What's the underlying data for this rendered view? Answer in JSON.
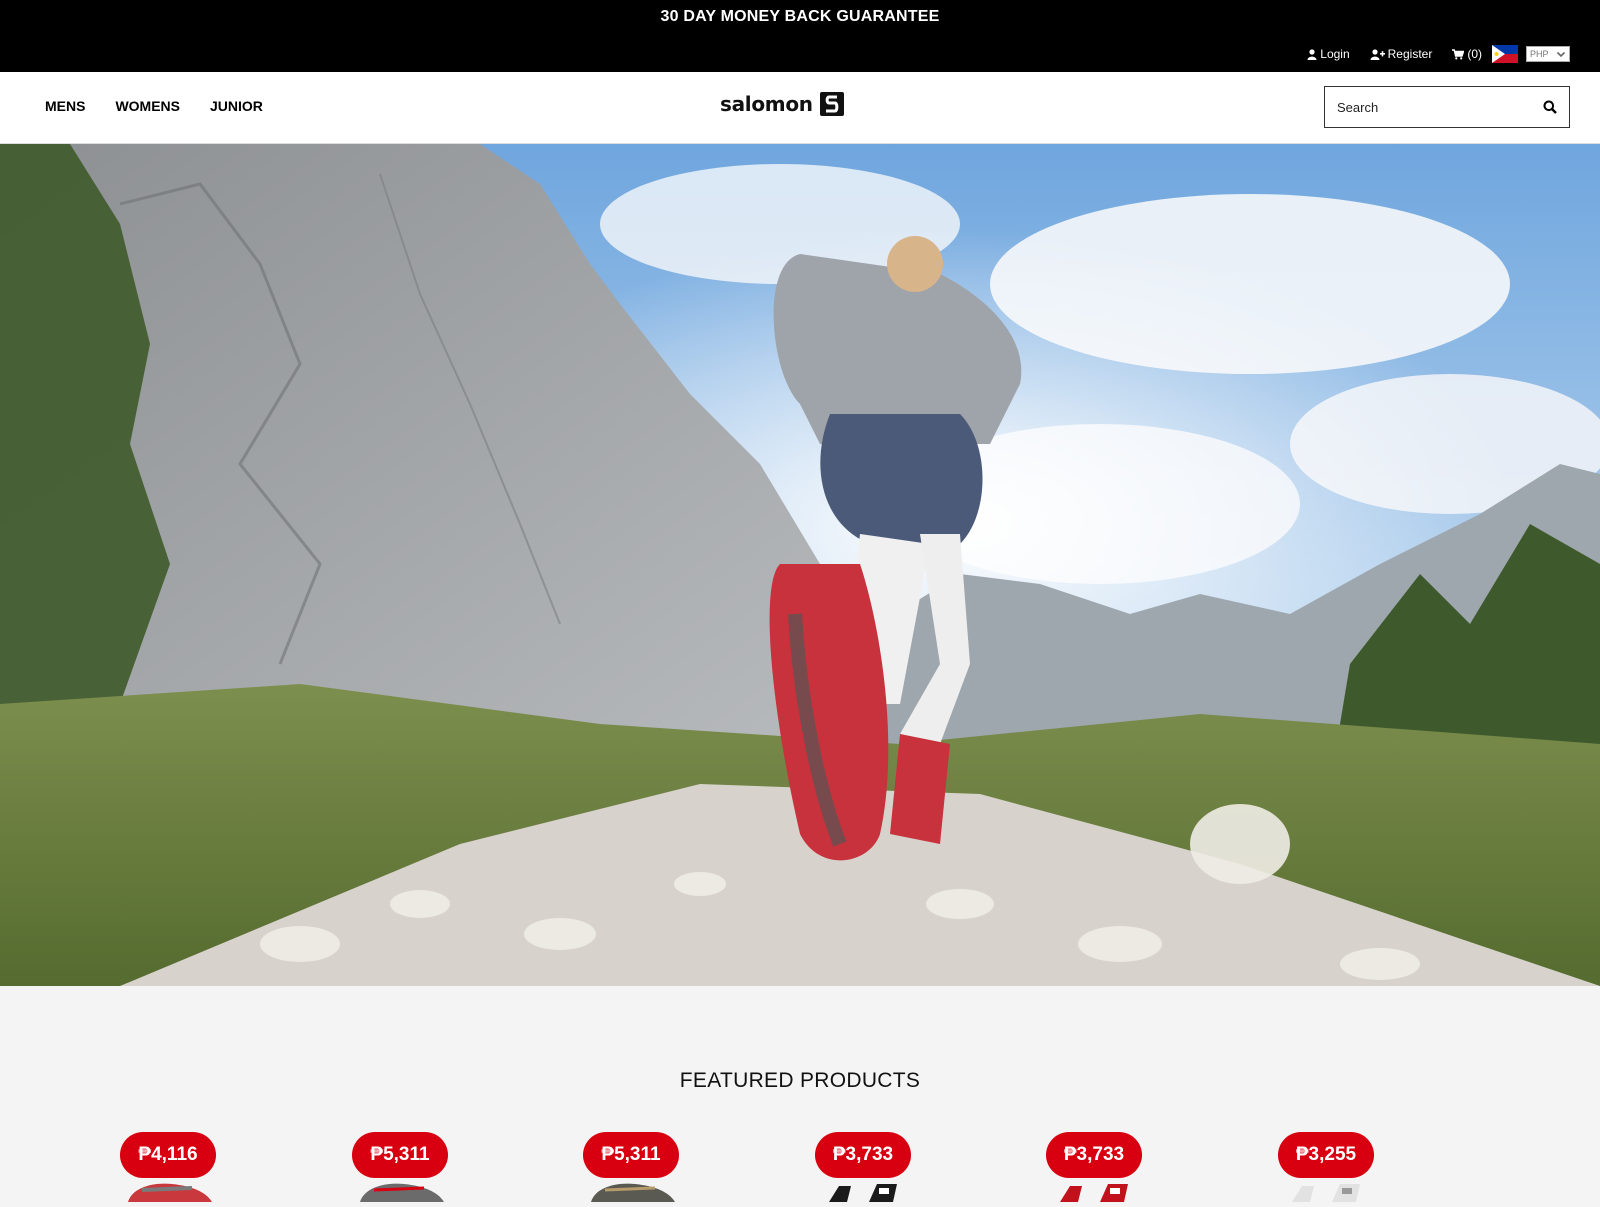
{
  "promo": {
    "text": "30 DAY MONEY BACK GUARANTEE"
  },
  "utility": {
    "login_label": "Login",
    "register_label": "Register",
    "cart_label": "(0)",
    "currency": "PHP"
  },
  "nav": {
    "items": [
      {
        "label": "MENS"
      },
      {
        "label": "WOMENS"
      },
      {
        "label": "JUNIOR"
      }
    ]
  },
  "brand": {
    "name": "salomon"
  },
  "search": {
    "placeholder": "Search"
  },
  "hero": {
    "alt": "Trail runner on a rocky mountain path"
  },
  "featured": {
    "title": "FEATURED PRODUCTS",
    "products": [
      {
        "price": "₱4,116",
        "color": "#c8383c"
      },
      {
        "price": "₱5,311",
        "color": "#6b6b6b"
      },
      {
        "price": "₱5,311",
        "color": "#5a5a52"
      },
      {
        "price": "₱3,733",
        "color": "#1b1b1b"
      },
      {
        "price": "₱3,733",
        "color": "#c1121c"
      },
      {
        "price": "₱3,255",
        "color": "#e2e2e2"
      }
    ]
  },
  "colors": {
    "accent": "#d80010",
    "topbar": "#000000"
  }
}
